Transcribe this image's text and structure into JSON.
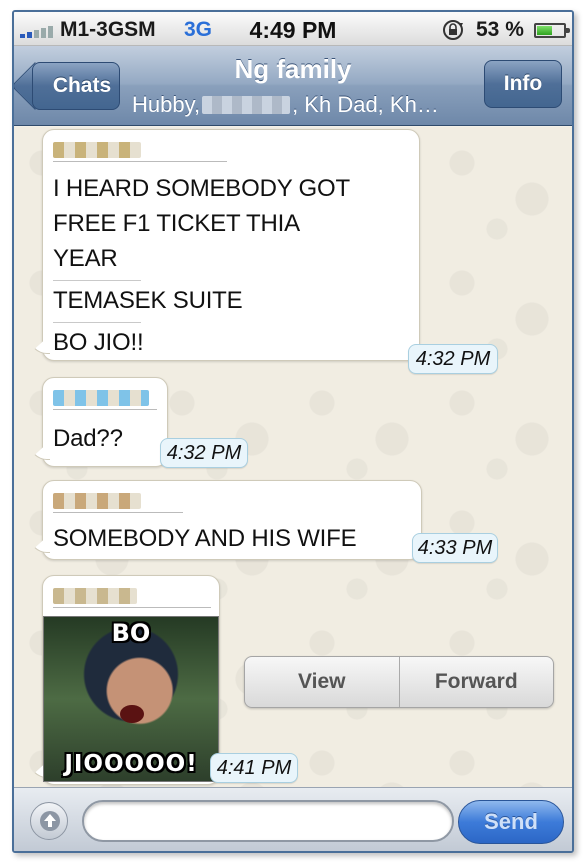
{
  "status_bar": {
    "carrier": "M1-3GSM",
    "network": "3G",
    "time": "4:49 PM",
    "battery_percent": "53 %",
    "battery_level": 0.53,
    "signal_icon": "signal-bars-icon",
    "lock_icon": "rotation-lock-icon"
  },
  "nav": {
    "back_label": "Chats",
    "title": "Ng family",
    "subtitle_start": "Hubby,",
    "subtitle_end": ", Kh Dad, Kh…",
    "info_label": "Info"
  },
  "messages": [
    {
      "sender_color": "#c9b37a",
      "lines": [
        "I HEARD SOMEBODY GOT",
        "FREE F1 TICKET THIA",
        "YEAR",
        "TEMASEK SUITE",
        "BO JIO!!"
      ],
      "time": "4:32 PM"
    },
    {
      "sender_color": "#7fc3e8",
      "lines": [
        "Dad??"
      ],
      "time": "4:32 PM"
    },
    {
      "sender_color": "#c9a87a",
      "lines": [
        "SOMEBODY AND HIS WIFE"
      ],
      "time": "4:33 PM"
    },
    {
      "sender_color": "#c9b88f",
      "image_caption_top": "BO",
      "image_caption_bottom": "JIOOOOO!",
      "time": "4:41 PM"
    }
  ],
  "image_actions": {
    "view_label": "View",
    "forward_label": "Forward"
  },
  "input": {
    "value": "",
    "placeholder": "",
    "send_label": "Send"
  },
  "colors": {
    "nav_blue": "#6e88a9",
    "send_blue": "#3d7bd9",
    "timestamp_bg": "#e9f5fb",
    "chat_bg": "#f1ede2"
  }
}
